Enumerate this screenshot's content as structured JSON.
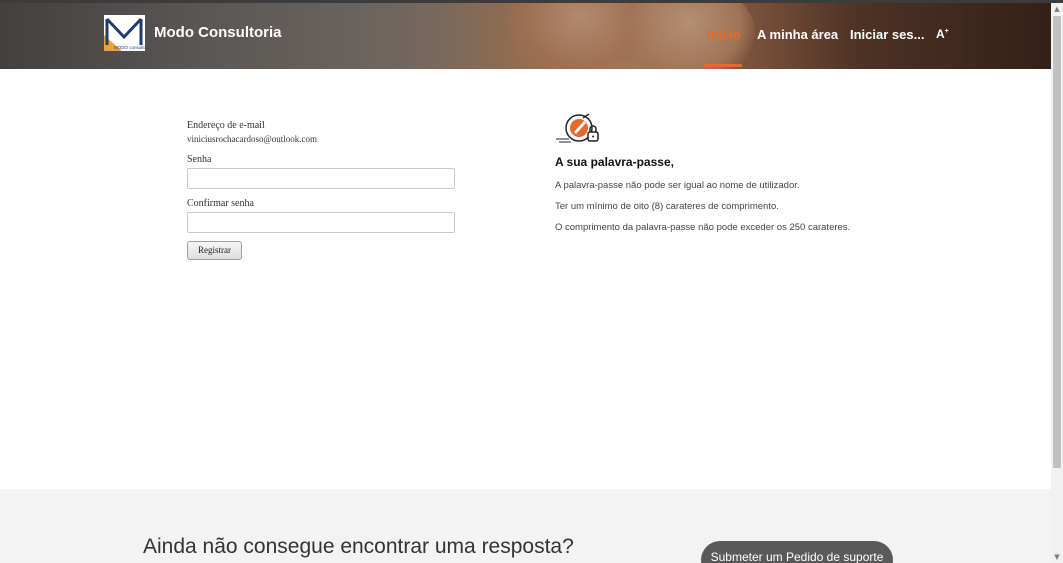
{
  "header": {
    "brand": "Modo Consultoria",
    "logo_text": "MODO consultoria",
    "nav": [
      {
        "label": "Início",
        "active": true
      },
      {
        "label": "A minha área",
        "active": false
      },
      {
        "label": "Iniciar ses...",
        "active": false
      }
    ],
    "font_toggle": "A"
  },
  "form": {
    "email_label": "Endereço de e-mail",
    "email_value": "viniciusrochacardoso@outlook.com",
    "password_label": "Senha",
    "password_value": "",
    "confirm_label": "Confirmar senha",
    "confirm_value": "",
    "submit_label": "Registrar"
  },
  "password_info": {
    "icon": "password-lock-icon",
    "title": "A sua palavra-passe,",
    "rules": [
      "A palavra-passe não pode ser igual ao nome de utilizador.",
      "Ter um mínimo de oito (8) carateres de comprimento.",
      "O comprimento da palavra-passe não pode exceder os 250 carateres."
    ]
  },
  "footer": {
    "title": "Ainda não consegue encontrar uma resposta?",
    "support_button": "Submeter um Pedido de suporte"
  },
  "colors": {
    "accent": "#e36a2b",
    "footer_bg": "#f3f3f3",
    "support_button_bg": "#5a5a5a"
  }
}
